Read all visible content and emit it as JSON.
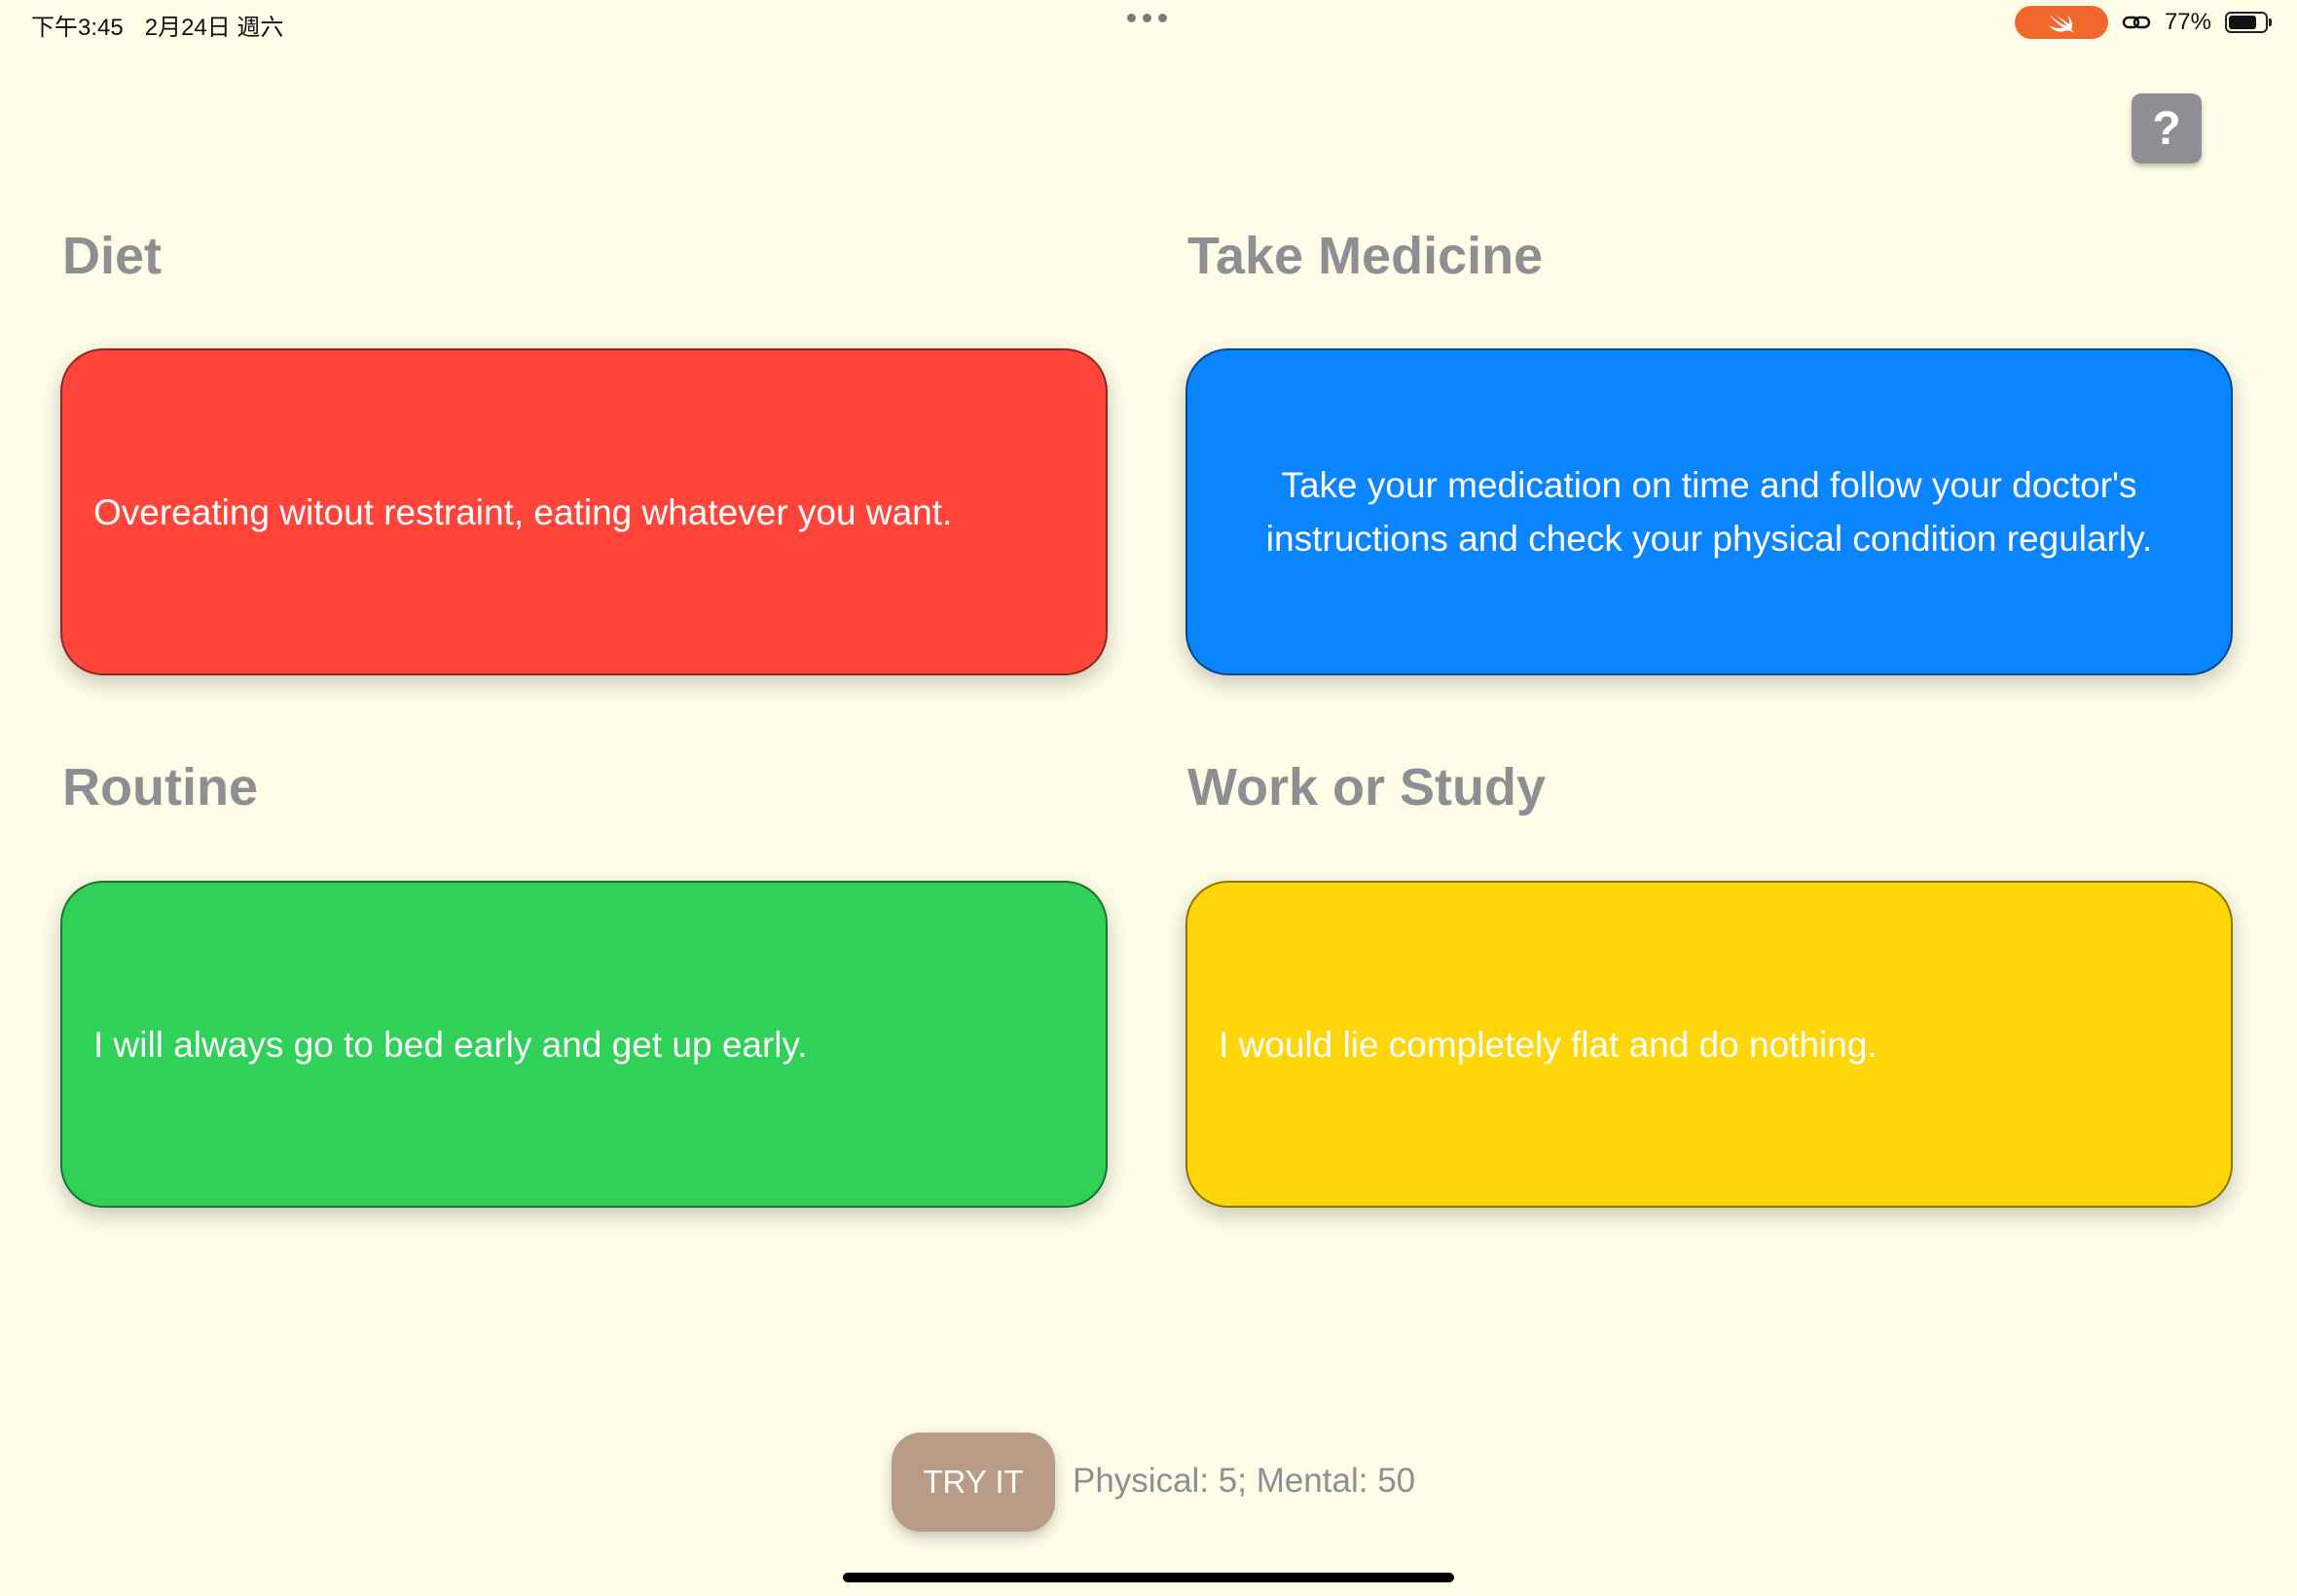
{
  "status_bar": {
    "time": "下午3:45",
    "date": "2月24日 週六",
    "battery": "77%",
    "battery_level": 0.77
  },
  "help": {
    "label": "?"
  },
  "sections": [
    {
      "title": "Diet",
      "text": "Overeating witout restraint, eating whatever you want.",
      "color": "#FF453A"
    },
    {
      "title": "Take Medicine",
      "text": "Take your medication on time and follow your doctor's instructions and check your physical condition regularly.",
      "color": "#0A84FF"
    },
    {
      "title": "Routine",
      "text": "I will always go to bed early and get up early.",
      "color": "#30D158"
    },
    {
      "title": "Work or Study",
      "text": "I would lie completely flat and do nothing.",
      "color": "#FFD60A"
    }
  ],
  "footer": {
    "try_label": "TRY IT",
    "score_text": "Physical: 5; Mental: 50"
  },
  "colors": {
    "background": "#FEFDE8",
    "title_gray": "#8E8E93",
    "try_button": "#B89C87",
    "swift_badge": "#F2672C"
  }
}
